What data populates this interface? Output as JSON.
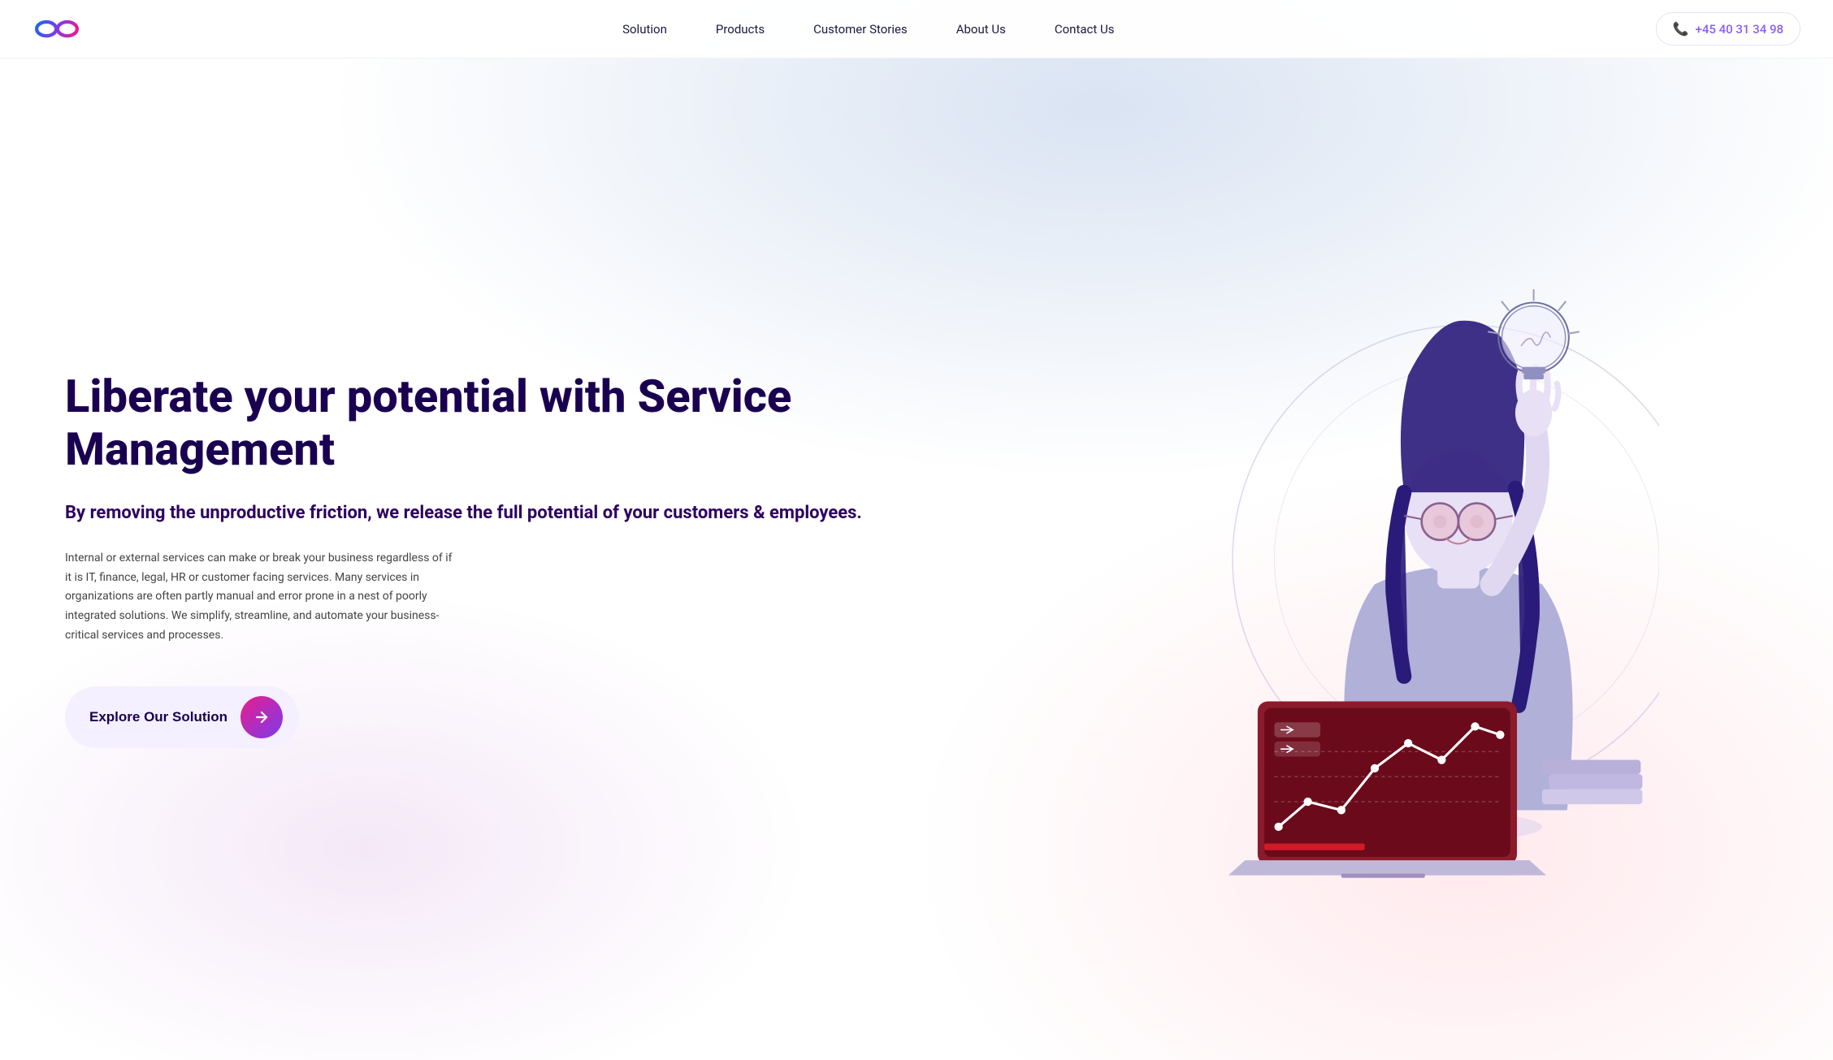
{
  "nav": {
    "logo_alt": "Company Logo",
    "links": [
      {
        "label": "Solution",
        "href": "#"
      },
      {
        "label": "Products",
        "href": "#"
      },
      {
        "label": "Customer Stories",
        "href": "#"
      },
      {
        "label": "About Us",
        "href": "#"
      },
      {
        "label": "Contact Us",
        "href": "#"
      }
    ],
    "phone": "+45 40 31 34 98"
  },
  "hero": {
    "headline": "Liberate your potential with Service Management",
    "subhead": "By removing the unproductive friction, we release the full potential of your customers & employees.",
    "body": "Internal or external services can make or break your business regardless of if it is IT, finance, legal, HR or customer facing services. Many services in organizations are often partly manual and error prone in a nest of poorly integrated solutions. We simplify, streamline, and automate your business-critical services and processes.",
    "cta_label": "Explore Our Solution",
    "cta_arrow": "→"
  }
}
